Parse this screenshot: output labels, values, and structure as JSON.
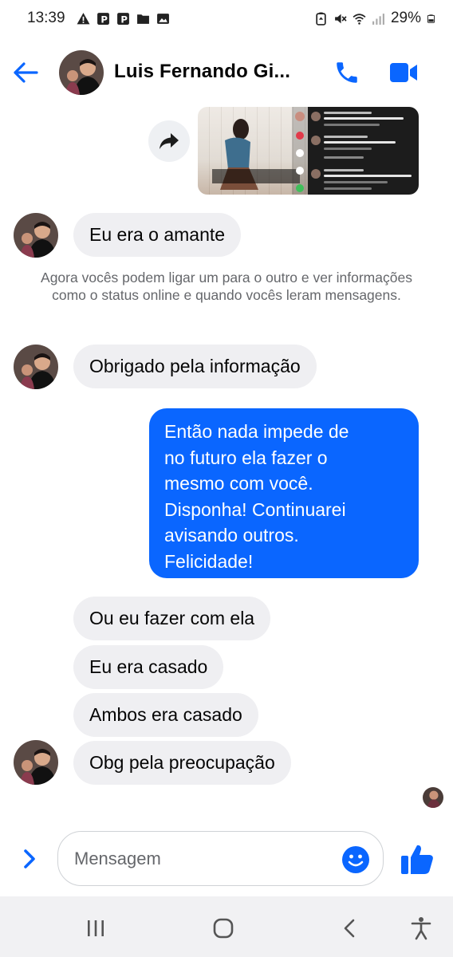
{
  "status_bar": {
    "time": "13:39",
    "battery_percent": "29%",
    "left_icons": [
      "warning-icon",
      "parking-icon",
      "parking-icon",
      "folder-icon",
      "image-icon"
    ],
    "right_icons": [
      "battery-saver-icon",
      "mute-icon",
      "wifi-icon",
      "signal-icon",
      "battery-icon"
    ]
  },
  "header": {
    "contact_name": "Luis Fernando Gi...",
    "accent_color": "#0a66ff"
  },
  "messages": {
    "m1": "Eu era o amante",
    "system_note": "Agora vocês podem ligar um para o outro e ver informações como o status online e quando vocês leram mensagens.",
    "m2": "Obrigado pela informação",
    "outgoing_lines": [
      "Então nada impede de",
      "no futuro ela fazer o",
      "mesmo com você.",
      "Disponha! Continuarei",
      "avisando outros.",
      "Felicidade!"
    ],
    "m3": "Ou eu fazer com ela",
    "m4": "Eu era casado",
    "m5": "Ambos era casado",
    "m6": "Obg pela preocupação"
  },
  "composer": {
    "placeholder": "Mensagem"
  },
  "colors": {
    "outgoing_bubble": "#0a66ff",
    "incoming_bubble": "#efeff2",
    "secondary_text": "#65676b"
  }
}
